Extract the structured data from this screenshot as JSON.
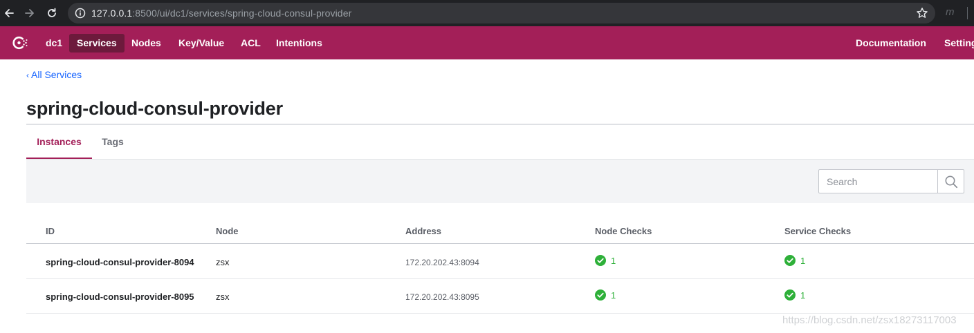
{
  "browser": {
    "url_host": "127.0.0.1",
    "url_rest": ":8500/ui/dc1/services/spring-cloud-consul-provider",
    "profile_initial": "m"
  },
  "topnav": {
    "datacenter": "dc1",
    "items": [
      "Services",
      "Nodes",
      "Key/Value",
      "ACL",
      "Intentions"
    ],
    "active": "Services",
    "right_items": [
      "Documentation",
      "Settings"
    ]
  },
  "breadcrumb": {
    "label": "All Services"
  },
  "page": {
    "title": "spring-cloud-consul-provider"
  },
  "tabs": [
    {
      "label": "Instances",
      "active": true
    },
    {
      "label": "Tags",
      "active": false
    }
  ],
  "search": {
    "placeholder": "Search",
    "value": ""
  },
  "table": {
    "headers": [
      "ID",
      "Node",
      "Address",
      "Node Checks",
      "Service Checks"
    ],
    "rows": [
      {
        "id": "spring-cloud-consul-provider-8094",
        "node": "zsx",
        "address": "172.20.202.43:8094",
        "node_checks": "1",
        "service_checks": "1"
      },
      {
        "id": "spring-cloud-consul-provider-8095",
        "node": "zsx",
        "address": "172.20.202.43:8095",
        "node_checks": "1",
        "service_checks": "1"
      }
    ]
  },
  "colors": {
    "brand": "#a31f58",
    "nav_active": "#6d1a3c",
    "link": "#1563ff",
    "passing": "#2eb039"
  },
  "icons": [
    "back-arrow-icon",
    "forward-arrow-icon",
    "reload-icon",
    "info-icon",
    "star-icon",
    "consul-logo-icon",
    "search-icon",
    "check-circle-icon"
  ],
  "watermark": "https://blog.csdn.net/zsx18273117003"
}
